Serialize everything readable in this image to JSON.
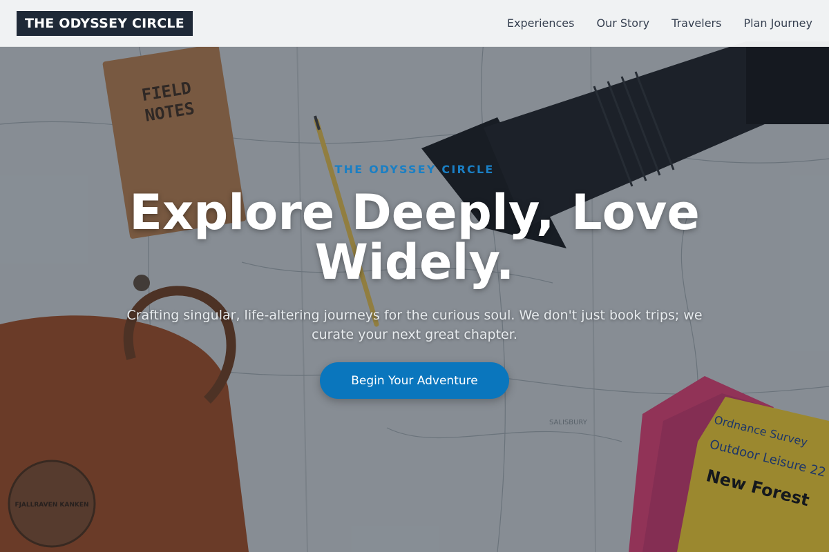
{
  "header": {
    "logo": "THE ODYSSEY CIRCLE",
    "nav": [
      {
        "label": "Experiences"
      },
      {
        "label": "Our Story"
      },
      {
        "label": "Travelers"
      },
      {
        "label": "Plan Journey"
      }
    ]
  },
  "hero": {
    "eyebrow": "THE ODYSSEY CIRCLE",
    "headline": "Explore Deeply, Love Widely.",
    "subtitle": "Crafting singular, life-altering journeys for the curious soul. We don't just book trips; we curate your next great chapter.",
    "cta_label": "Begin Your Adventure"
  },
  "photo": {
    "notebook": {
      "line1": "FIELD",
      "line2": "NOTES"
    },
    "map_label": "SALISBURY",
    "backpack_badge": "FJALLRAVEN KANKEN",
    "guide_brand": "Ordnance Survey",
    "guide_series": "Outdoor Leisure 22",
    "guide_title": "New Forest"
  },
  "colors": {
    "accent": "#0a76bd",
    "eyebrow": "#1a7fc4",
    "logo_bg": "#1f2937",
    "header_bg": "#f5f6f7"
  }
}
